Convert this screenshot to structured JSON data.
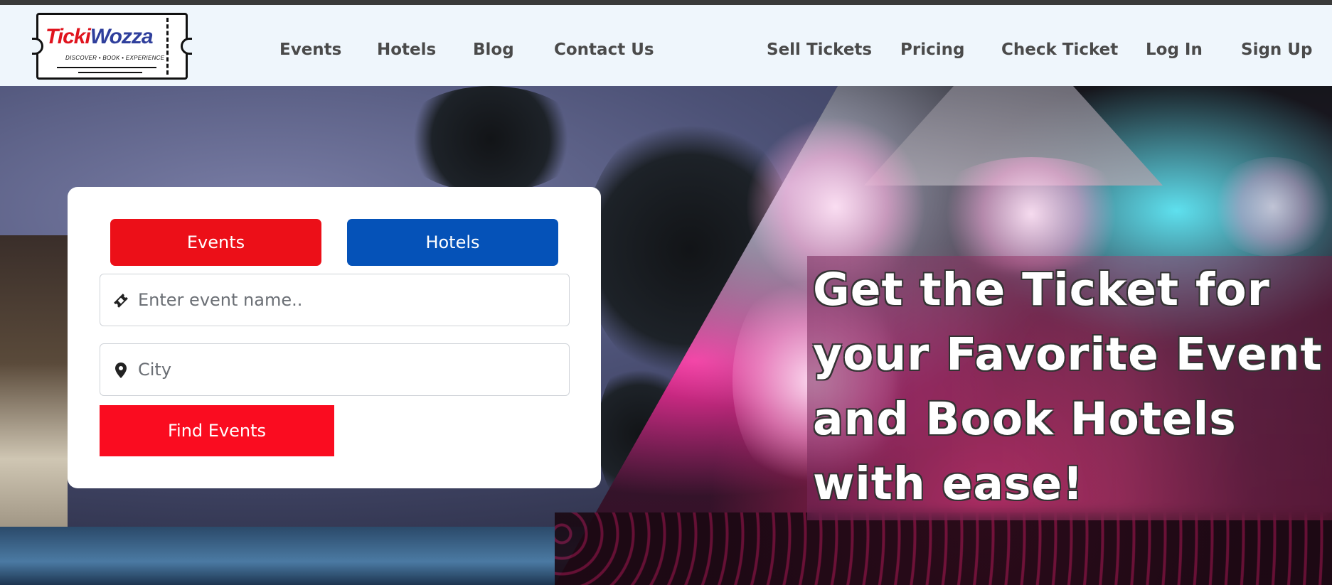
{
  "header": {
    "logo": {
      "brand_part1": "Ticki",
      "brand_part2": "Wozza",
      "tagline": "DISCOVER • BOOK • EXPERIENCE"
    },
    "nav_left": [
      "Events",
      "Hotels",
      "Blog",
      "Contact Us"
    ],
    "nav_right": [
      "Sell Tickets",
      "Pricing",
      "Check Ticket",
      "Log In",
      "Sign Up"
    ]
  },
  "search": {
    "tabs": {
      "events": "Events",
      "hotels": "Hotels"
    },
    "event_field": {
      "placeholder": "Enter event name..",
      "icon": "ticket-icon"
    },
    "city_field": {
      "placeholder": "City",
      "icon": "map-pin-icon"
    },
    "submit_label": "Find Events"
  },
  "hero": {
    "headline": "Get the Ticket for your Favorite Event and Book Hotels with ease!"
  },
  "colors": {
    "header_bg": "#eff6fc",
    "events_tab": "#ec0f18",
    "hotels_tab": "#0552b8",
    "find_button": "#fa0c20",
    "nav_text": "#4a4a4a"
  }
}
